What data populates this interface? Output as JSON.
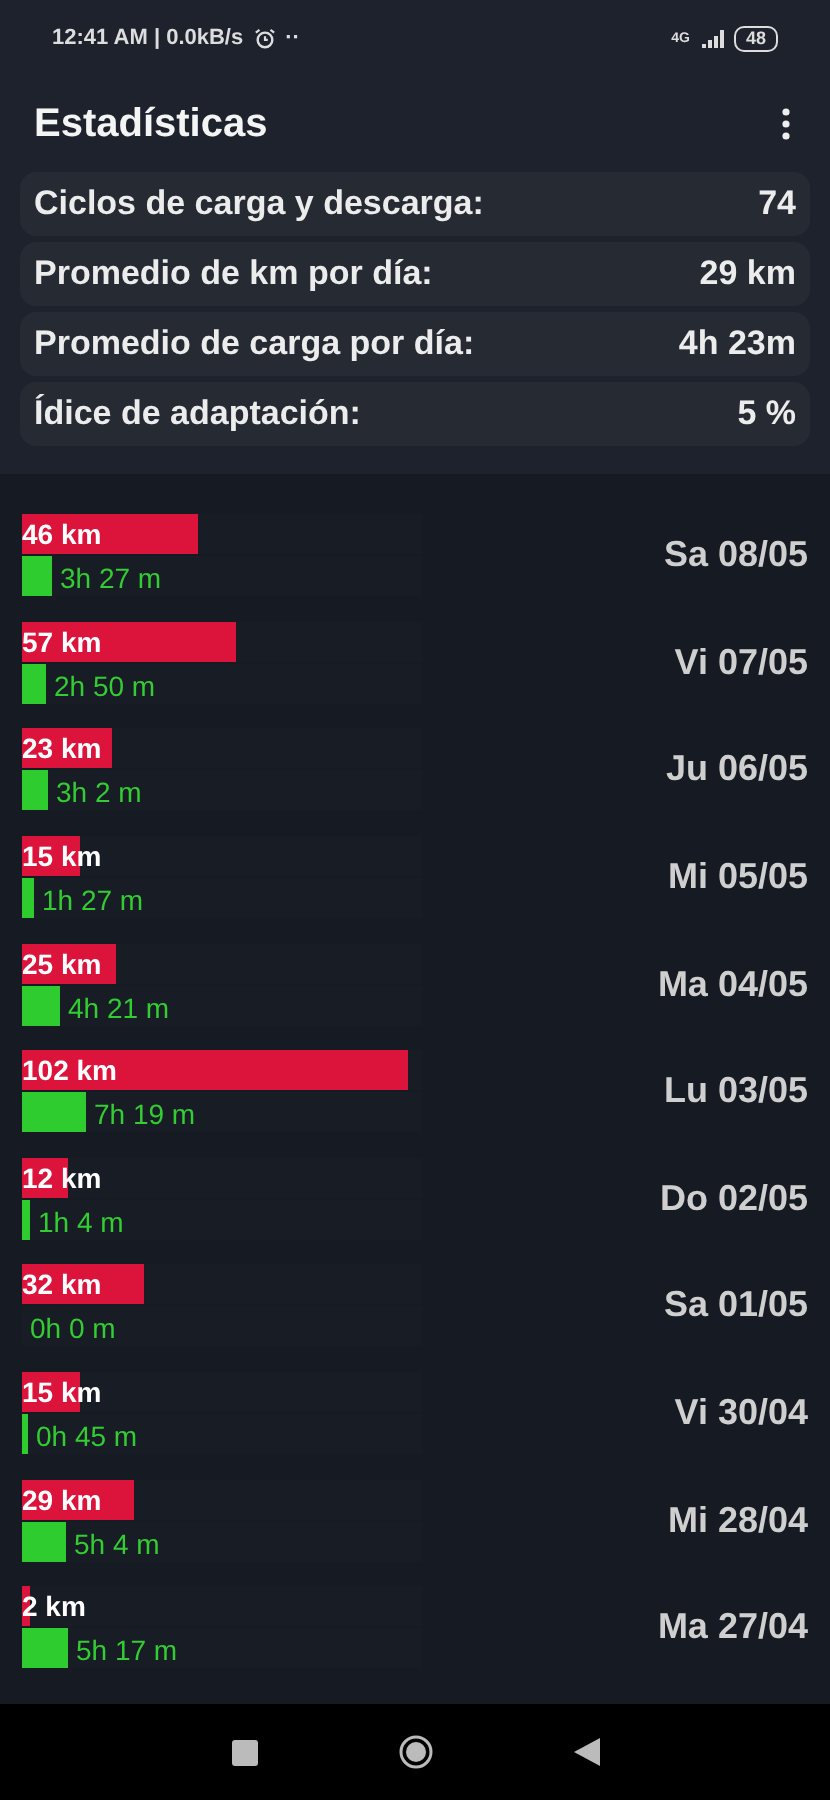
{
  "status_bar": {
    "time": "12:41 AM | 0.0kB/s",
    "dots": "··",
    "network": "4G",
    "battery": "48"
  },
  "app_bar": {
    "title": "Estadísticas"
  },
  "stats": [
    {
      "label": "Ciclos de carga y descarga:",
      "value": "74"
    },
    {
      "label": "Promedio de km por día:",
      "value": "29 km"
    },
    {
      "label": "Promedio de carga por día:",
      "value": "4h 23m"
    },
    {
      "label": "Ídice de adaptación:",
      "value": "5 %"
    }
  ],
  "days": [
    {
      "distance": {
        "text": "46 km",
        "level": 0.44
      },
      "charge": {
        "text": "3h 27 m",
        "level": 0.075
      },
      "date": "Sa 08/05"
    },
    {
      "distance": {
        "text": "57 km",
        "level": 0.535
      },
      "charge": {
        "text": "2h 50 m",
        "level": 0.06
      },
      "date": "Vi 07/05"
    },
    {
      "distance": {
        "text": "23 km",
        "level": 0.225
      },
      "charge": {
        "text": "3h 2 m",
        "level": 0.065
      },
      "date": "Ju 06/05"
    },
    {
      "distance": {
        "text": "15 km",
        "level": 0.145
      },
      "charge": {
        "text": "1h 27 m",
        "level": 0.03
      },
      "date": "Mi 05/05"
    },
    {
      "distance": {
        "text": "25 km",
        "level": 0.235
      },
      "charge": {
        "text": "4h 21 m",
        "level": 0.095
      },
      "date": "Ma 04/05"
    },
    {
      "distance": {
        "text": "102 km",
        "level": 0.965
      },
      "charge": {
        "text": "7h 19 m",
        "level": 0.16
      },
      "date": "Lu 03/05"
    },
    {
      "distance": {
        "text": "12 km",
        "level": 0.115
      },
      "charge": {
        "text": "1h 4 m",
        "level": 0.02
      },
      "date": "Do 02/05"
    },
    {
      "distance": {
        "text": "32 km",
        "level": 0.305
      },
      "charge": {
        "text": "0h 0 m",
        "level": 0
      },
      "date": "Sa 01/05"
    },
    {
      "distance": {
        "text": "15 km",
        "level": 0.145
      },
      "charge": {
        "text": "0h 45 m",
        "level": 0.015
      },
      "date": "Vi 30/04"
    },
    {
      "distance": {
        "text": "29 km",
        "level": 0.28
      },
      "charge": {
        "text": "5h 4 m",
        "level": 0.11
      },
      "date": "Mi 28/04"
    },
    {
      "distance": {
        "text": "2 km",
        "level": 0.02
      },
      "charge": {
        "text": "5h 17 m",
        "level": 0.115
      },
      "date": "Ma 27/04"
    }
  ]
}
